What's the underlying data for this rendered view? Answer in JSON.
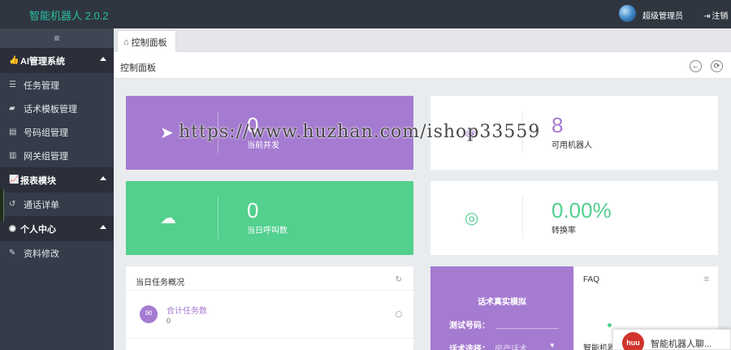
{
  "app": {
    "brand": "智能机器人 2.0.2",
    "admin_name": "超级管理员",
    "logout_label": "注销"
  },
  "sidebar": {
    "toggle_icon": "hamburger-icon",
    "groups": [
      {
        "label": "AI管理系统",
        "icon": "thumbs-up-icon",
        "items": [
          {
            "label": "任务管理",
            "icon": "list-icon"
          },
          {
            "label": "话术模板管理",
            "icon": "book-icon"
          },
          {
            "label": "号码组管理",
            "icon": "card-icon"
          },
          {
            "label": "网关组管理",
            "icon": "map-icon"
          }
        ]
      },
      {
        "label": "报表模块",
        "icon": "chart-icon",
        "items": [
          {
            "label": "通话详单",
            "icon": "history-icon"
          }
        ]
      },
      {
        "label": "个人中心",
        "icon": "user-icon",
        "items": [
          {
            "label": "资料修改",
            "icon": "edit-icon"
          }
        ]
      }
    ]
  },
  "tabs": [
    {
      "label": "控制面板",
      "icon": "home-icon"
    }
  ],
  "panel": {
    "title": "控制面板"
  },
  "stats": {
    "concurrent": {
      "value": "0",
      "label": "当前并发",
      "icon": "paper-plane-icon"
    },
    "robots": {
      "value": "8",
      "label": "可用机器人",
      "icon": "tag-icon"
    },
    "calls": {
      "value": "0",
      "label": "当日呼叫数",
      "icon": "cloud-upload-icon"
    },
    "conversion": {
      "value": "0.00%",
      "label": "转换率",
      "icon": "target-icon"
    }
  },
  "task_overview": {
    "title": "当日任务概况",
    "item_label": "合计任务数",
    "item_value": "0"
  },
  "simulation": {
    "title": "话术真实模拟",
    "phone_label": "测试号码：",
    "select_label": "话术选择：",
    "select_value": "房产话术"
  },
  "faq": {
    "title": "FAQ",
    "text_cut": "智能机器"
  },
  "chat_widget": {
    "logo_text": "huu",
    "label": "智能机器人聊..."
  },
  "watermark": "https://www.huzhan.com/ishop33559",
  "colors": {
    "purple": "#a57bd1",
    "green": "#52d08e",
    "sidebar": "#353b48",
    "topbar": "#2f3640",
    "brand": "#2bbfa4"
  }
}
